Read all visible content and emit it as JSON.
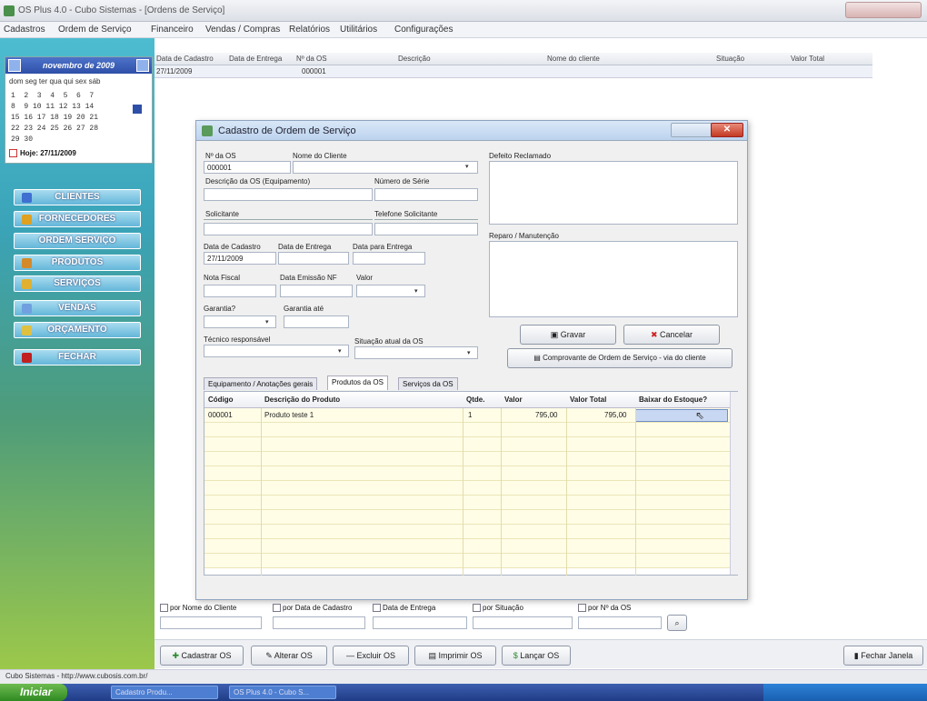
{
  "window": {
    "title": "OS Plus 4.0 - Cubo Sistemas - [Ordens de Serviço]"
  },
  "menu": [
    "Cadastros",
    "Ordem de Serviço",
    "Financeiro",
    "Vendas / Compras",
    "Relatórios",
    "Utilitários",
    "Configurações"
  ],
  "calendar": {
    "month_label": "novembro de 2009",
    "weekdays": "dom  seg  ter  qua  qui  sex  sáb",
    "rows": [
      "1  2  3  4  5  6  7",
      "8  9 10 11 12 13 14",
      "15 16 17 18 19 20 21",
      "22 23 24 25 26 27 28",
      "29 30"
    ],
    "today_label": "Hoje: 27/11/2009"
  },
  "sidebar_buttons": [
    "CLIENTES",
    "FORNECEDORES",
    "ORDEM SERVIÇO",
    "PRODUTOS",
    "SERVIÇOS",
    "VENDAS",
    "ORÇAMENTO",
    "FECHAR"
  ],
  "os_table": {
    "columns": [
      "Data de Cadastro",
      "Data de Entrega",
      "Nº da OS",
      "Descrição",
      "Nome do cliente",
      "Situação",
      "Valor Total"
    ],
    "row": {
      "data_cadastro": "27/11/2009",
      "numero": "000001"
    }
  },
  "dialog": {
    "title": "Cadastro de Ordem de Serviço",
    "labels": {
      "numero_os": "Nº da OS",
      "nome_cliente": "Nome do Cliente",
      "descricao_os": "Descrição da OS (Equipamento)",
      "numero_serie": "Número de Série",
      "solicitante": "Solicitante",
      "telefone_solicitante": "Telefone Solicitante",
      "data_cadastro": "Data de Cadastro",
      "data_entrega": "Data de Entrega",
      "data_para_entrega": "Data para Entrega",
      "nota_fiscal": "Nota Fiscal",
      "data_emissao_nf": "Data Emissão NF",
      "valor": "Valor",
      "garantia": "Garantia?",
      "garantia_ate": "Garantia até",
      "tecnico_responsavel": "Técnico responsável",
      "situacao_atual": "Situação atual da OS",
      "defeito_reclamado": "Defeito Reclamado",
      "reparo": "Reparo / Manutenção"
    },
    "values": {
      "numero_os": "000001",
      "data_cadastro": "27/11/2009"
    },
    "buttons": {
      "gravar": "Gravar",
      "cancelar": "Cancelar",
      "comprovante": "Comprovante de Ordem de Serviço - via do cliente"
    },
    "tabs": [
      "Equipamento / Anotações gerais",
      "Produtos da OS",
      "Serviços da OS"
    ],
    "grid": {
      "columns": [
        "Código",
        "Descrição do Produto",
        "Qtde.",
        "Valor",
        "Valor Total",
        "Baixar do Estoque?"
      ],
      "rows": [
        {
          "codigo": "000001",
          "descricao": "Produto teste 1",
          "qtde": "1",
          "valor": "795,00",
          "valor_total": "795,00"
        }
      ]
    }
  },
  "filters": [
    "por Nome do Cliente",
    "por Data de Cadastro",
    "Data de Entrega",
    "por Situação",
    "por Nº da OS"
  ],
  "bottom_buttons": [
    "Cadastrar OS",
    "Alterar OS",
    "Excluir OS",
    "Imprimir OS",
    "Lançar OS",
    "Fechar Janela"
  ],
  "status_text": "Cubo Sistemas - http://www.cubosis.com.br/",
  "taskbar": {
    "start": "Iniciar",
    "tasks": [
      "Cadastro Produ...",
      "OS Plus 4.0 - Cubo S..."
    ]
  }
}
